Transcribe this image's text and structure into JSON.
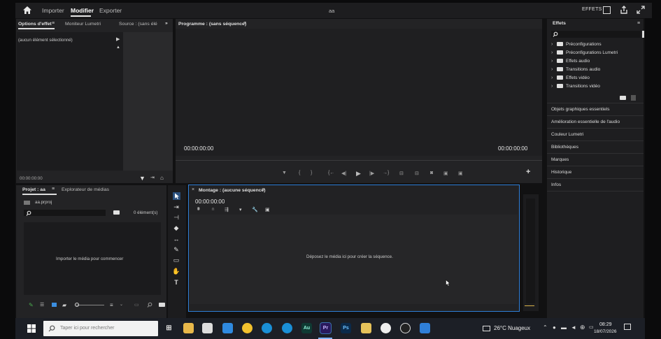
{
  "app": {
    "title": "aa",
    "tabs": [
      "Importer",
      "Modifier",
      "Exporter"
    ],
    "active_tab": "Modifier",
    "top_right_label": "EFFETS"
  },
  "effect_controls": {
    "tabs": [
      "Options d'effet",
      "Moniteur Lumetri",
      "Source : (sans élé"
    ],
    "no_selection": "(aucun élément sélectionné)",
    "timecode": "00:00:00:00"
  },
  "program": {
    "title": "Programme : (sans séquence)",
    "timecode_left": "00:00:00:00",
    "timecode_right": "00:00:00:00"
  },
  "effects_panel": {
    "title": "Effets",
    "items": [
      "Préconfigurations",
      "Préconfigurations Lumetri",
      "Effets audio",
      "Transitions audio",
      "Effets vidéo",
      "Transitions vidéo"
    ],
    "side_panels": [
      "Objets graphiques essentiels",
      "Amélioration essentielle de l'audio",
      "Couleur Lumetri",
      "Bibliothèques",
      "Marques",
      "Historique",
      "Infos"
    ]
  },
  "project": {
    "tabs": [
      "Projet : aa",
      "Explorateur de médias"
    ],
    "file": "aa.prproj",
    "count": "0 élément(s)",
    "empty_msg": "Importer le média pour commencer"
  },
  "timeline": {
    "title": "Montage : (aucune séquence)",
    "timecode": "00:00:00:00",
    "drop_msg": "Déposez le média ici pour créer la séquence."
  },
  "taskbar": {
    "search_placeholder": "Taper ici pour rechercher",
    "weather": "26°C Nuageux",
    "time": "08:29",
    "date": "18/07/2026",
    "apps": [
      "Au",
      "Pr",
      "Ps"
    ]
  },
  "colors": {
    "accent_blue": "#2f7fd8",
    "premiere": "#2a1a5e",
    "photoshop": "#0b2a4a",
    "audition": "#0f3a33"
  }
}
